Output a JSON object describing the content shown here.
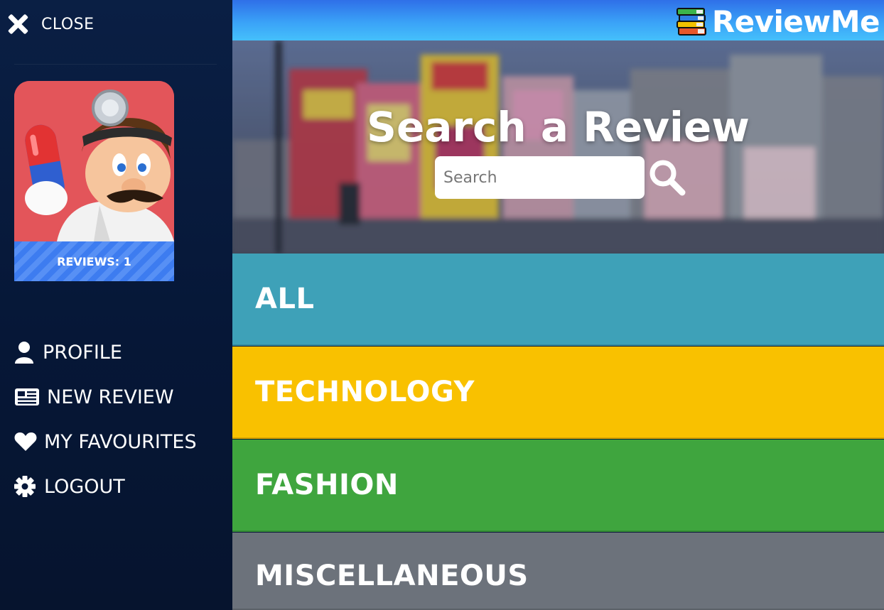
{
  "sidebar": {
    "close_label": "CLOSE",
    "reviews_label": "REVIEWS: 1",
    "menu": [
      {
        "label": "PROFILE",
        "icon": "user-icon"
      },
      {
        "label": "NEW REVIEW",
        "icon": "newspaper-icon"
      },
      {
        "label": "MY FAVOURITES",
        "icon": "heart-icon"
      },
      {
        "label": "LOGOUT",
        "icon": "gear-icon"
      }
    ]
  },
  "header": {
    "brand": "ReviewMe"
  },
  "hero": {
    "title": "Search a Review",
    "search_placeholder": "Search"
  },
  "categories": [
    {
      "label": "ALL",
      "color": "#3ea1b8"
    },
    {
      "label": "TECHNOLOGY",
      "color": "#f9c100"
    },
    {
      "label": "FASHION",
      "color": "#3fa53e"
    },
    {
      "label": "MISCELLANEOUS",
      "color": "#6c727b"
    }
  ]
}
